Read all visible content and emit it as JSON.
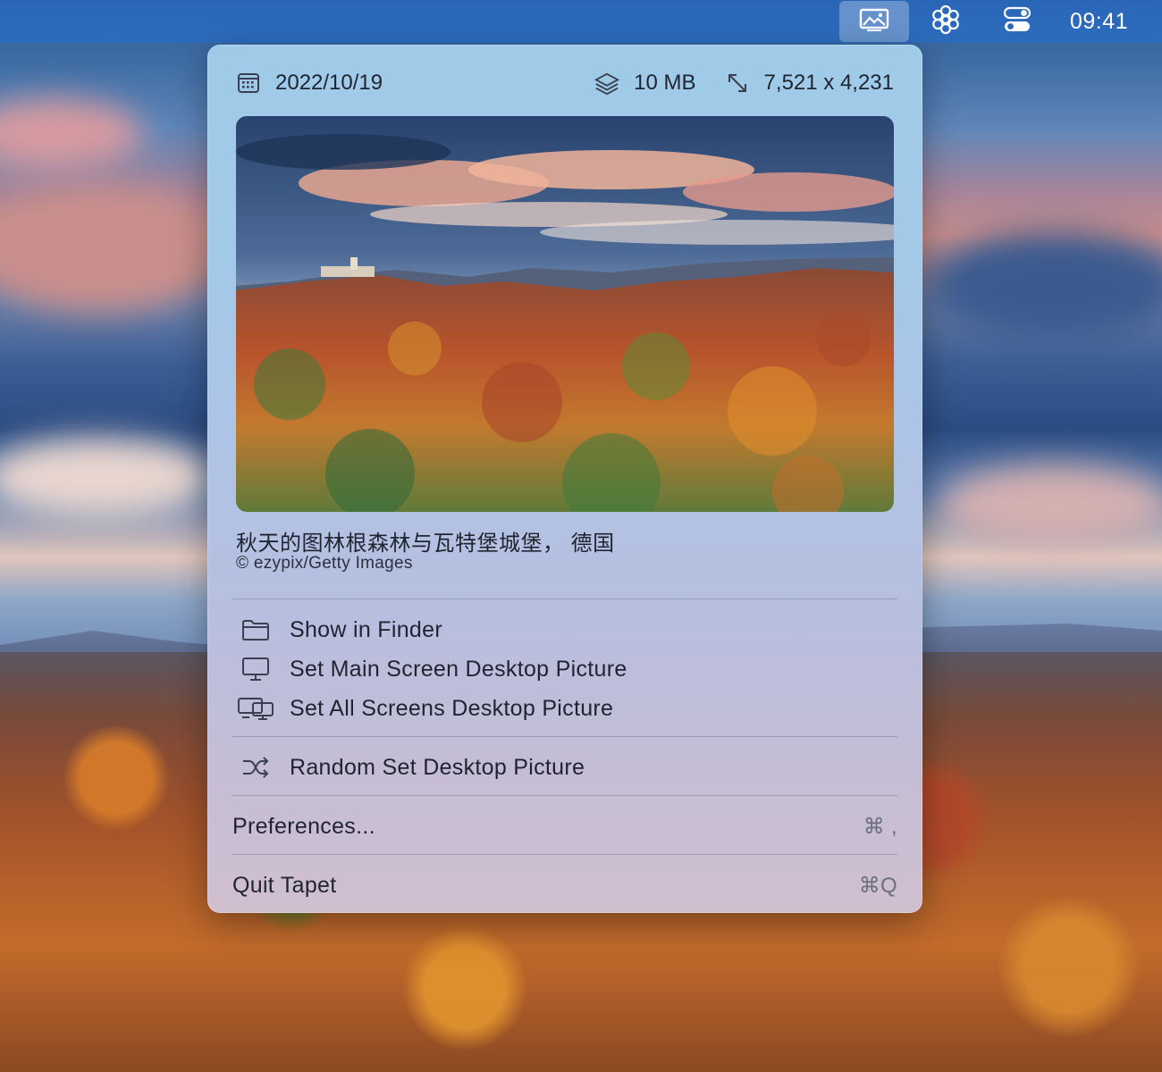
{
  "menubar": {
    "icons": [
      "wallpaper-icon",
      "flower-icon",
      "control-center-icon"
    ],
    "clock": "09:41"
  },
  "panel": {
    "date": "2022/10/19",
    "size": "10 MB",
    "dimensions": "7,521 x 4,231",
    "caption": "秋天的图林根森林与瓦特堡城堡， 德国",
    "copyright": "© ezypix/Getty Images",
    "menu": {
      "show_in_finder": "Show in Finder",
      "set_main": "Set Main Screen Desktop Picture",
      "set_all": "Set All Screens Desktop Picture",
      "random": "Random Set Desktop Picture",
      "preferences": "Preferences...",
      "preferences_shortcut": "⌘ ,",
      "quit": "Quit Tapet",
      "quit_shortcut": "⌘Q"
    }
  },
  "colors": {
    "menubar": "#2a66b8",
    "panel_top": "#9fcbe8",
    "panel_bottom": "#d0bfcf"
  }
}
